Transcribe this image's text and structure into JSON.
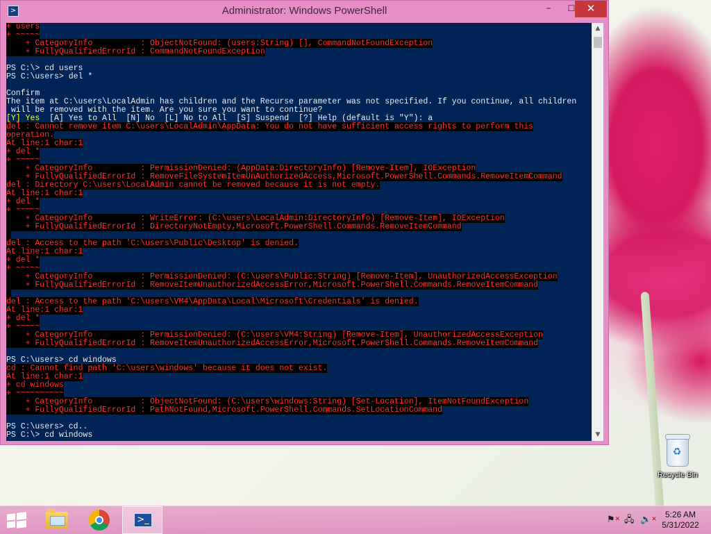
{
  "window": {
    "title": "Administrator: Windows PowerShell",
    "app_icon": "powershell-icon",
    "controls": {
      "minimize": "–",
      "maximize": "☐",
      "close": "✕"
    }
  },
  "console": {
    "lines": [
      {
        "text": "+ users",
        "type": "error"
      },
      {
        "text": "+ ~~~~~",
        "type": "error"
      },
      {
        "text": "    + CategoryInfo          : ObjectNotFound: (users:String) [], CommandNotFoundException",
        "type": "error"
      },
      {
        "text": "    + FullyQualifiedErrorId : CommandNotFoundException",
        "type": "error"
      },
      {
        "text": "",
        "type": "plain"
      },
      {
        "text": "PS C:\\> cd users",
        "type": "plain"
      },
      {
        "text": "PS C:\\users> del *",
        "type": "plain"
      },
      {
        "text": "",
        "type": "plain"
      },
      {
        "text": "Confirm",
        "type": "plain"
      },
      {
        "text": "The item at C:\\users\\LocalAdmin has children and the Recurse parameter was not specified. If you continue, all children",
        "type": "plain"
      },
      {
        "text": " will be removed with the item. Are you sure you want to continue?",
        "type": "plain"
      },
      {
        "text": "[Y] Yes",
        "type": "choice",
        "rest": "  [A] Yes to All  [N] No  [L] No to All  [S] Suspend  [?] Help (default is \"Y\"): a"
      },
      {
        "text": "del : Cannot remove item C:\\users\\LocalAdmin\\AppData: You do not have sufficient access rights to perform this",
        "type": "error"
      },
      {
        "text": "operation.",
        "type": "error"
      },
      {
        "text": "At line:1 char:1",
        "type": "error"
      },
      {
        "text": "+ del *",
        "type": "error"
      },
      {
        "text": "+ ~~~~~",
        "type": "error"
      },
      {
        "text": "    + CategoryInfo          : PermissionDenied: (AppData:DirectoryInfo) [Remove-Item], IOException",
        "type": "error"
      },
      {
        "text": "    + FullyQualifiedErrorId : RemoveFileSystemItemUnAuthorizedAccess,Microsoft.PowerShell.Commands.RemoveItemCommand",
        "type": "error"
      },
      {
        "text": "del : Directory C:\\users\\LocalAdmin cannot be removed because it is not empty.",
        "type": "error"
      },
      {
        "text": "At line:1 char:1",
        "type": "error"
      },
      {
        "text": "+ del *",
        "type": "error"
      },
      {
        "text": "+ ~~~~~",
        "type": "error"
      },
      {
        "text": "    + CategoryInfo          : WriteError: (C:\\users\\LocalAdmin:DirectoryInfo) [Remove-Item], IOException",
        "type": "error"
      },
      {
        "text": "    + FullyQualifiedErrorId : DirectoryNotEmpty,Microsoft.PowerShell.Commands.RemoveItemCommand",
        "type": "error"
      },
      {
        "text": " ",
        "type": "error"
      },
      {
        "text": "del : Access to the path 'C:\\users\\Public\\Desktop' is denied.",
        "type": "error"
      },
      {
        "text": "At line:1 char:1",
        "type": "error"
      },
      {
        "text": "+ del *",
        "type": "error"
      },
      {
        "text": "+ ~~~~~",
        "type": "error"
      },
      {
        "text": "    + CategoryInfo          : PermissionDenied: (C:\\users\\Public:String) [Remove-Item], UnauthorizedAccessException",
        "type": "error"
      },
      {
        "text": "    + FullyQualifiedErrorId : RemoveItemUnauthorizedAccessError,Microsoft.PowerShell.Commands.RemoveItemCommand",
        "type": "error"
      },
      {
        "text": " ",
        "type": "error"
      },
      {
        "text": "del : Access to the path 'C:\\users\\VM4\\AppData\\Local\\Microsoft\\Credentials' is denied.",
        "type": "error"
      },
      {
        "text": "At line:1 char:1",
        "type": "error"
      },
      {
        "text": "+ del *",
        "type": "error"
      },
      {
        "text": "+ ~~~~~",
        "type": "error"
      },
      {
        "text": "    + CategoryInfo          : PermissionDenied: (C:\\users\\VM4:String) [Remove-Item], UnauthorizedAccessException",
        "type": "error"
      },
      {
        "text": "    + FullyQualifiedErrorId : RemoveItemUnauthorizedAccessError,Microsoft.PowerShell.Commands.RemoveItemCommand",
        "type": "error"
      },
      {
        "text": "",
        "type": "plain"
      },
      {
        "text": "PS C:\\users> cd windows",
        "type": "plain"
      },
      {
        "text": "cd : Cannot find path 'C:\\users\\windows' because it does not exist.",
        "type": "error"
      },
      {
        "text": "At line:1 char:1",
        "type": "error"
      },
      {
        "text": "+ cd windows",
        "type": "error"
      },
      {
        "text": "+ ~~~~~~~~~~",
        "type": "error"
      },
      {
        "text": "    + CategoryInfo          : ObjectNotFound: (C:\\users\\windows:String) [Set-Location], ItemNotFoundException",
        "type": "error"
      },
      {
        "text": "    + FullyQualifiedErrorId : PathNotFound,Microsoft.PowerShell.Commands.SetLocationCommand",
        "type": "error"
      },
      {
        "text": "",
        "type": "plain"
      },
      {
        "text": "PS C:\\users> cd..",
        "type": "plain"
      },
      {
        "text": "PS C:\\> cd windows",
        "type": "plain"
      }
    ]
  },
  "desktop": {
    "recycle_bin_label": "Recycle Bin"
  },
  "taskbar": {
    "items": [
      "start-button",
      "file-explorer",
      "chrome",
      "powershell"
    ],
    "clock": {
      "time": "5:26 AM",
      "date": "5/31/2022"
    }
  }
}
